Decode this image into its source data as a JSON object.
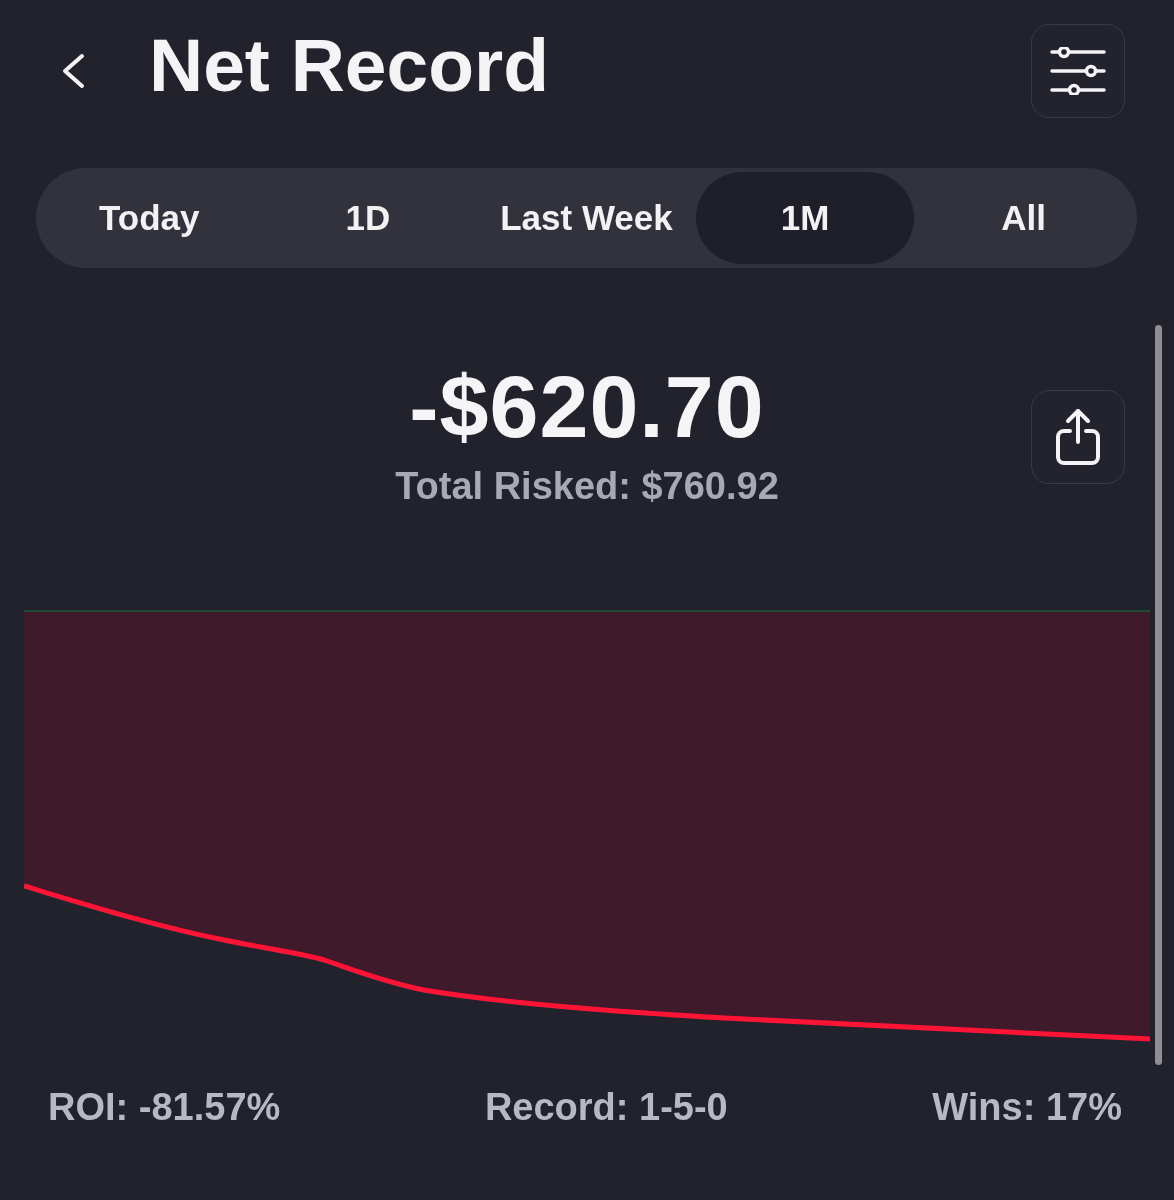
{
  "header": {
    "title": "Net Record"
  },
  "periods": [
    {
      "label": "Today",
      "selected": false
    },
    {
      "label": "1D",
      "selected": false
    },
    {
      "label": "Last Week",
      "selected": false
    },
    {
      "label": "1M",
      "selected": true
    },
    {
      "label": "All",
      "selected": false
    }
  ],
  "summary": {
    "net": "-$620.70",
    "total_risked": "Total Risked: $760.92"
  },
  "chart": {
    "kind": "area"
  },
  "stats": [
    "ROI: -81.57%",
    "Record: 1-5-0",
    "Wins: 17%"
  ]
}
